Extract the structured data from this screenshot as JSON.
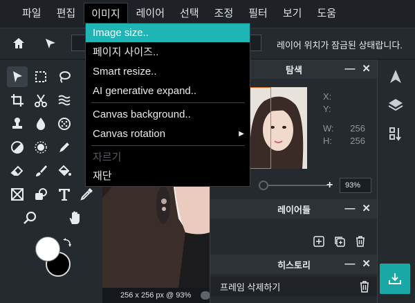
{
  "menubar": {
    "items": [
      {
        "label": "파일"
      },
      {
        "label": "편집"
      },
      {
        "label": "이미지"
      },
      {
        "label": "레이어"
      },
      {
        "label": "선택"
      },
      {
        "label": "조정"
      },
      {
        "label": "필터"
      },
      {
        "label": "보기"
      },
      {
        "label": "도움"
      }
    ],
    "active_index": 2
  },
  "optionsbar": {
    "lock_status": "레이어 위치가 잠금된 상태랍니다."
  },
  "image_menu": {
    "items": [
      {
        "label": "Image size..",
        "highlighted": true
      },
      {
        "label": "페이지 사이즈.."
      },
      {
        "label": "Smart resize.."
      },
      {
        "label": "AI generative expand.."
      },
      {
        "label": "Canvas background.."
      },
      {
        "label": "Canvas rotation",
        "submenu": true
      },
      {
        "label": "자르기",
        "disabled": true
      },
      {
        "label": "재단"
      }
    ]
  },
  "canvas": {
    "status": "256 x 256 px @ 93%"
  },
  "navigator": {
    "title": "탐색",
    "x_label": "X:",
    "y_label": "Y:",
    "w_label": "W:",
    "h_label": "H:",
    "w_value": "256",
    "h_value": "256",
    "zoom": "93%",
    "minimize": "—",
    "close": "✕"
  },
  "layers": {
    "title": "레이어들",
    "minimize": "—",
    "close": "✕"
  },
  "history": {
    "title": "히스토리",
    "minimize": "—",
    "close": "✕",
    "entries": [
      {
        "label": "프레임 삭제하기"
      }
    ]
  },
  "colors": {
    "accent": "#1fb5b5",
    "export_button": "#19a8a6",
    "foreground": "#ffffff",
    "background": "#000000",
    "navigator_viewport": "#e8742c"
  }
}
